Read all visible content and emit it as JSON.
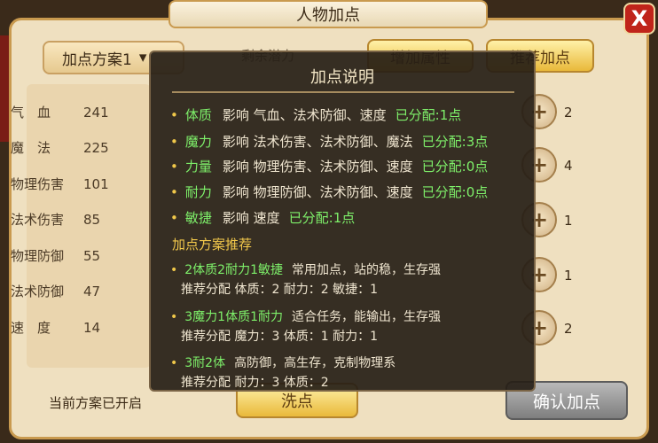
{
  "window": {
    "title": "人物加点",
    "close_label": "X"
  },
  "toolbar": {
    "scheme": "加点方案1",
    "remaining_label": "剩余潜力",
    "add_attr_label": "增加属性",
    "recommend_label": "推荐加点"
  },
  "stats": [
    {
      "name": "气　血",
      "value": "241"
    },
    {
      "name": "魔　法",
      "value": "225"
    },
    {
      "name": "物理伤害",
      "value": "101"
    },
    {
      "name": "法术伤害",
      "value": "85"
    },
    {
      "name": "物理防御",
      "value": "55"
    },
    {
      "name": "法术防御",
      "value": "47"
    },
    {
      "name": "速　度",
      "value": "14"
    }
  ],
  "attr_points": [
    "2",
    "4",
    "1",
    "1",
    "2"
  ],
  "footer": {
    "status": "当前方案已开启",
    "wash_label": "洗点",
    "confirm_label": "确认加点"
  },
  "tooltip": {
    "title": "加点说明",
    "attributes": [
      {
        "name": "体质",
        "effect": "影响  气血、法术防御、速度",
        "assigned": "已分配:1点"
      },
      {
        "name": "魔力",
        "effect": "影响  法术伤害、法术防御、魔法",
        "assigned": "已分配:3点"
      },
      {
        "name": "力量",
        "effect": "影响  物理伤害、法术防御、速度",
        "assigned": "已分配:0点"
      },
      {
        "name": "耐力",
        "effect": "影响  物理防御、法术防御、速度",
        "assigned": "已分配:0点"
      },
      {
        "name": "敏捷",
        "effect": "影响  速度",
        "assigned": "已分配:1点"
      }
    ],
    "rec_heading": "加点方案推荐",
    "recommendations": [
      {
        "name": "2体质2耐力1敏捷",
        "desc": "常用加点，站的稳，生存强",
        "alloc": "推荐分配  体质：2  耐力：2  敏捷：1"
      },
      {
        "name": "3魔力1体质1耐力",
        "desc": "适合任务，能输出，生存强",
        "alloc": "推荐分配  魔力：3  体质：1  耐力：1"
      },
      {
        "name": "3耐2体",
        "desc": "高防御，高生存，克制物理系",
        "alloc": "推荐分配  耐力：3  体质：2"
      }
    ]
  }
}
